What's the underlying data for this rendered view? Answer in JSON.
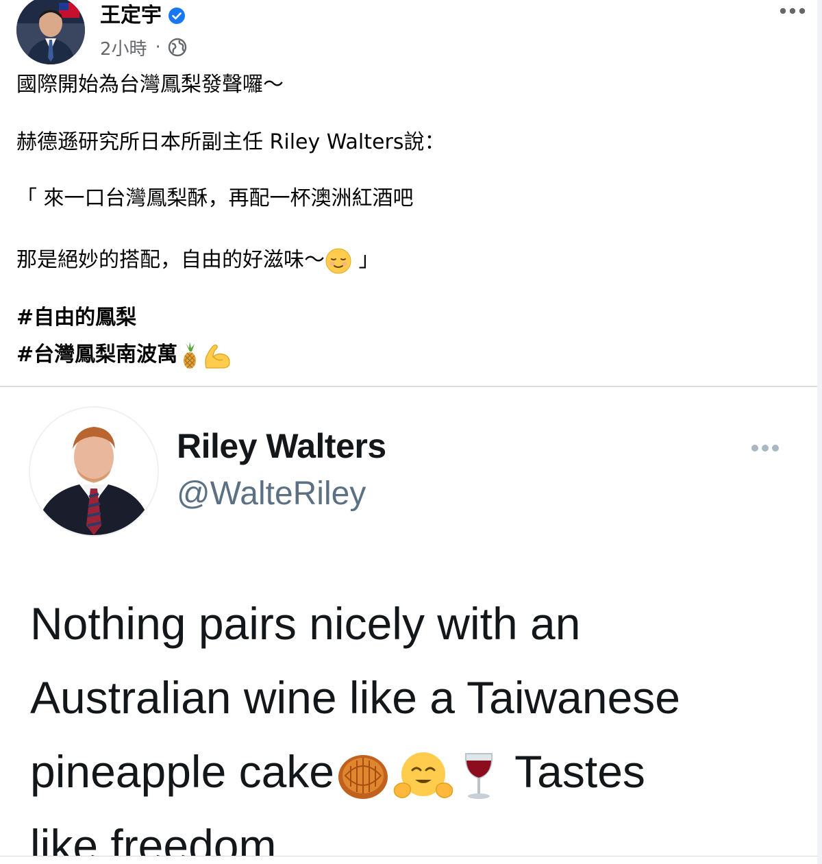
{
  "post": {
    "author": {
      "name": "王定宇",
      "verified": true
    },
    "meta": {
      "time": "2小時",
      "separator": "·",
      "audience_icon": "globe-icon"
    },
    "more_icon": "more-horizontal-icon",
    "body": {
      "line1": "國際開始為台灣鳳梨發聲囉～",
      "line2": "赫德遜研究所日本所副主任 Riley Walters說：",
      "line3": "「 來一口台灣鳳梨酥，再配一杯澳洲紅酒吧",
      "line4_text": "那是絕妙的搭配，自由的好滋味～",
      "line4_emoji": "smiling-face-icon",
      "line4_close": " 」",
      "hashtag1": "#自由的鳳梨",
      "hashtag2": "#台灣鳳梨南波萬",
      "hashtag2_emojis": [
        "pineapple-icon",
        "flexed-biceps-icon"
      ]
    }
  },
  "tweet": {
    "name": "Riley Walters",
    "handle": "@WalteRiley",
    "more_icon": "more-horizontal-icon",
    "lines": {
      "line1": "Nothing pairs nicely with an",
      "line2": "Australian wine like a Taiwanese",
      "line3_text": "pineapple cake",
      "line3_emojis": [
        "moon-cake-icon",
        "hugging-face-icon",
        "wine-glass-icon"
      ],
      "line3_after": " Tastes",
      "line4": "like freedom"
    }
  },
  "colors": {
    "verified_blue": "#1877f2",
    "meta_gray": "#65676b",
    "tweet_handle_gray": "#5b7083",
    "divider": "#dadde1"
  }
}
